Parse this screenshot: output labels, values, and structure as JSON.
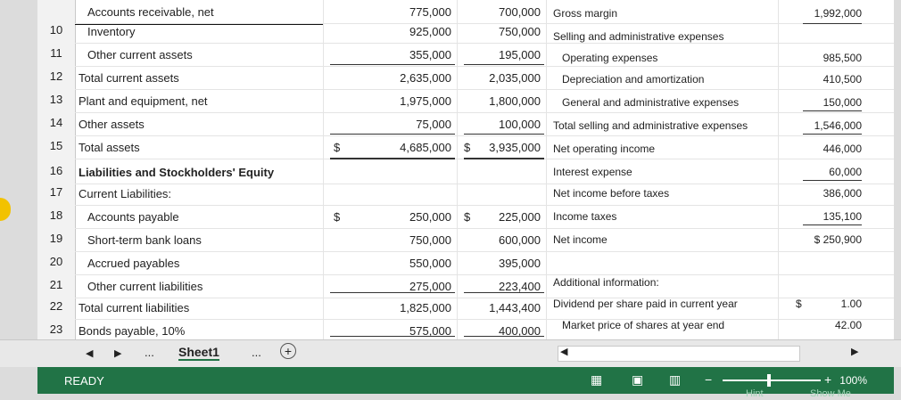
{
  "rows": [
    {
      "num": "",
      "label": "Accounts receivable, net",
      "c1": "775,000",
      "c2": "700,000"
    },
    {
      "num": "10",
      "label": "Inventory",
      "c1": "925,000",
      "c2": "750,000"
    },
    {
      "num": "11",
      "label": "Other current assets",
      "c1": "355,000",
      "c2": "195,000"
    },
    {
      "num": "12",
      "label": "Total current assets",
      "c1": "2,635,000",
      "c2": "2,035,000"
    },
    {
      "num": "13",
      "label": "Plant and equipment, net",
      "c1": "1,975,000",
      "c2": "1,800,000"
    },
    {
      "num": "14",
      "label": "Other assets",
      "c1": "75,000",
      "c2": "100,000"
    },
    {
      "num": "15",
      "label": "Total assets",
      "c1": "4,685,000",
      "c2": "3,935,000",
      "dollar1": "$",
      "dollar2": "$"
    },
    {
      "num": "16",
      "label": "Liabilities and Stockholders' Equity",
      "c1": "",
      "c2": ""
    },
    {
      "num": "17",
      "label": "Current Liabilities:",
      "c1": "",
      "c2": ""
    },
    {
      "num": "18",
      "label": "Accounts payable",
      "c1": "250,000",
      "c2": "225,000",
      "dollar1": "$",
      "dollar2": "$"
    },
    {
      "num": "19",
      "label": "Short-term bank loans",
      "c1": "750,000",
      "c2": "600,000"
    },
    {
      "num": "20",
      "label": "Accrued payables",
      "c1": "550,000",
      "c2": "395,000"
    },
    {
      "num": "21",
      "label": "Other current liabilities",
      "c1": "275,000",
      "c2": "223,400"
    },
    {
      "num": "22",
      "label": "Total current liabilities",
      "c1": "1,825,000",
      "c2": "1,443,400"
    },
    {
      "num": "23",
      "label": "Bonds payable, 10%",
      "c1": "575,000",
      "c2": "400,000"
    }
  ],
  "income": [
    {
      "label": "Gross margin",
      "value": "1,992,000"
    },
    {
      "label": "Selling and administrative expenses",
      "value": ""
    },
    {
      "label": "Operating expenses",
      "value": "985,500"
    },
    {
      "label": "Depreciation and amortization",
      "value": "410,500"
    },
    {
      "label": "General and administrative expenses",
      "value": "150,000"
    },
    {
      "label": "Total selling and administrative expenses",
      "value": "1,546,000"
    },
    {
      "label": "Net operating income",
      "value": "446,000"
    },
    {
      "label": "Interest expense",
      "value": "60,000"
    },
    {
      "label": "Net income before taxes",
      "value": "386,000"
    },
    {
      "label": "Income taxes",
      "value": "135,100"
    },
    {
      "label": "Net income",
      "value": "$ 250,900"
    },
    {
      "label": "",
      "value": ""
    },
    {
      "label": "Additional information:",
      "value": ""
    },
    {
      "label": "Dividend per share paid in current year",
      "value": "1.00",
      "dollar": "$"
    },
    {
      "label": "Market price of shares at year end",
      "value": "42.00"
    }
  ],
  "tabs": {
    "ellipsis": "...",
    "sheet": "Sheet1",
    "after": "...",
    "add": "+"
  },
  "status": {
    "ready": "READY",
    "zoom": "100%",
    "hint": "Hint",
    "show_me": "Show Me"
  }
}
